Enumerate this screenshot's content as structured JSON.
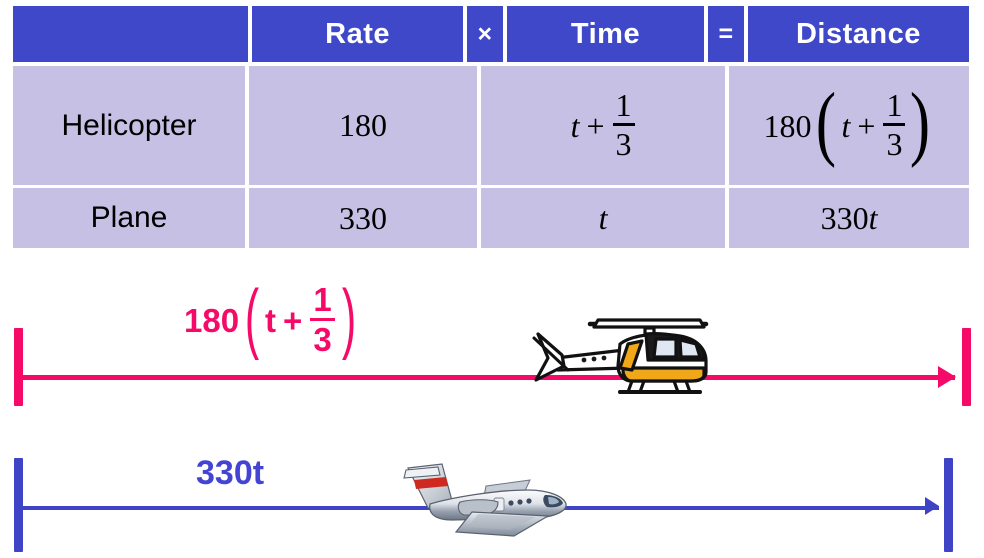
{
  "table": {
    "header": {
      "corner": "",
      "rate": "Rate",
      "times_op": "×",
      "time": "Time",
      "equals_op": "=",
      "distance": "Distance"
    },
    "rows": [
      {
        "label": "Helicopter",
        "rate": "180",
        "time_var": "t",
        "time_plus": "+",
        "time_frac_num": "1",
        "time_frac_den": "3",
        "distance_coef": "180",
        "distance_open": "(",
        "distance_var": "t",
        "distance_plus": "+",
        "distance_frac_num": "1",
        "distance_frac_den": "3",
        "distance_close": ")"
      },
      {
        "label": "Plane",
        "rate": "330",
        "time_var": "t",
        "distance_coef": "330",
        "distance_var": "t"
      }
    ]
  },
  "diagrams": [
    {
      "name": "helicopter",
      "color": "#f50a68",
      "label_coef": "180",
      "label_open": "(",
      "label_var": "t",
      "label_plus": "+",
      "label_frac_num": "1",
      "label_frac_den": "3",
      "label_close": ")",
      "vehicle_icon": "helicopter-icon"
    },
    {
      "name": "plane",
      "color": "#4444d4",
      "label": "330t",
      "vehicle_icon": "airplane-icon"
    }
  ]
}
